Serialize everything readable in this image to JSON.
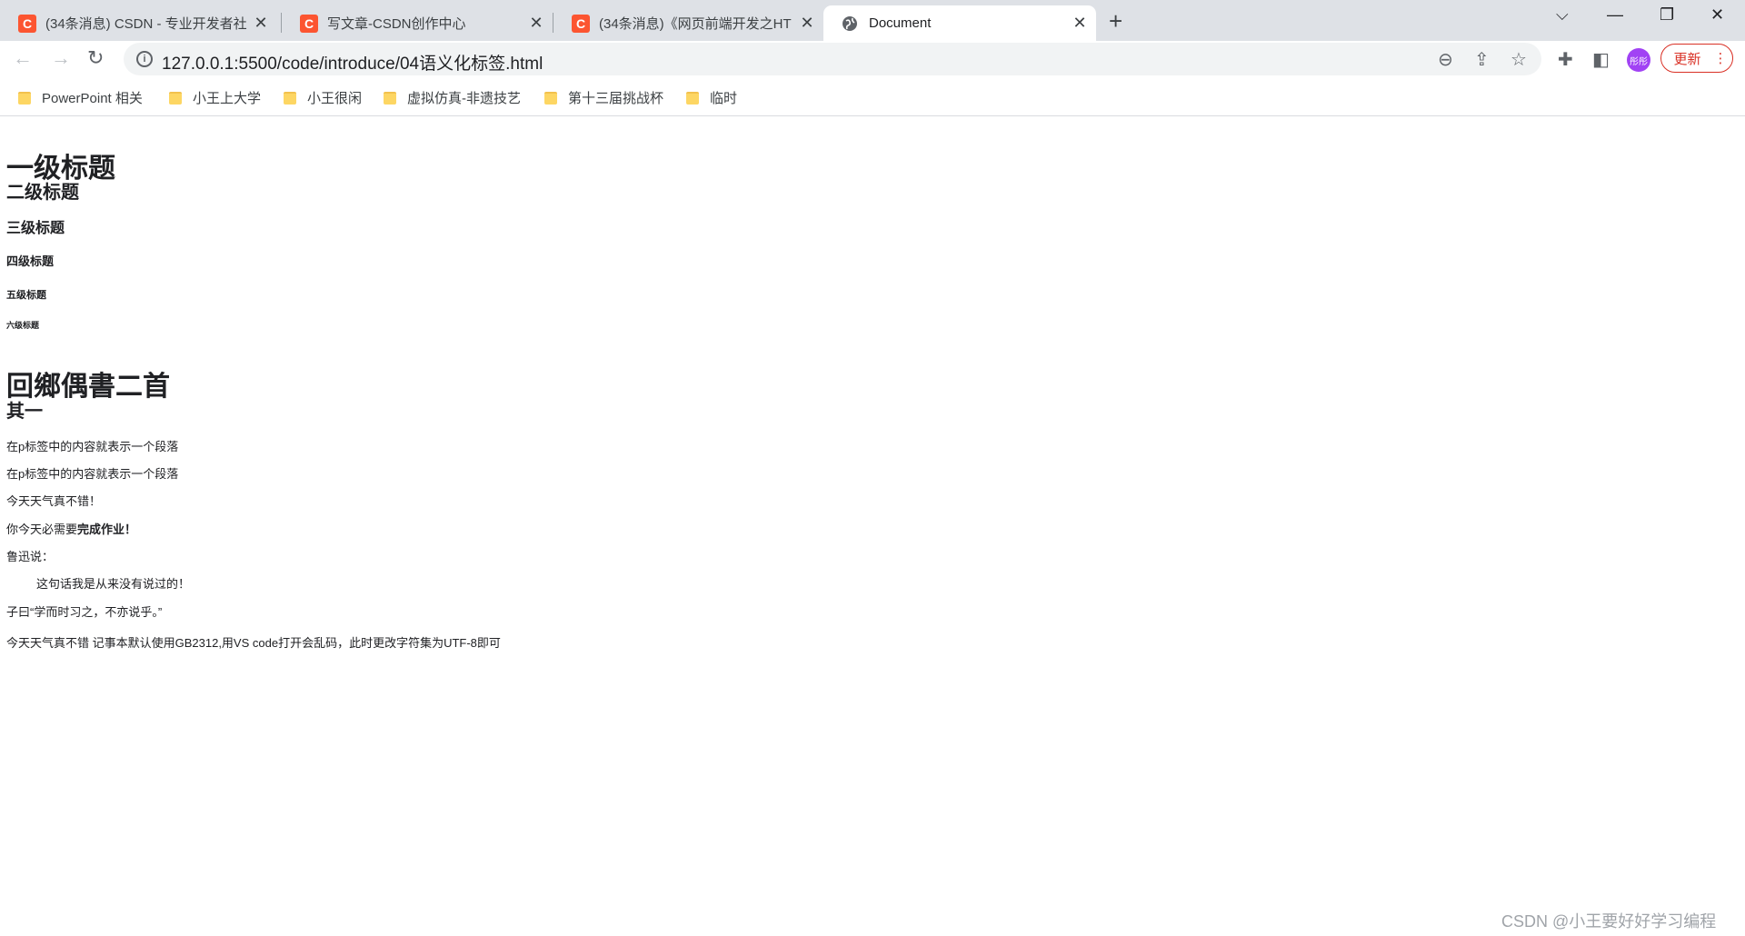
{
  "browser": {
    "tabs": [
      {
        "title": "(34条消息) CSDN - 专业开发者社",
        "favicon": "C"
      },
      {
        "title": "写文章-CSDN创作中心",
        "favicon": "C"
      },
      {
        "title": "(34条消息)《网页前端开发之HT",
        "favicon": "C"
      },
      {
        "title": "Document",
        "favicon": "globe-icon"
      }
    ],
    "new_tab": "+",
    "url": "127.0.0.1:5500/code/introduce/04语义化标签.html",
    "update_label": "更新",
    "avatar_text": "彤彤",
    "accent_color": "#d93025"
  },
  "bookmarks": [
    {
      "label": "PowerPoint 相关"
    },
    {
      "label": "小王上大学"
    },
    {
      "label": "小王很闲"
    },
    {
      "label": "虚拟仿真-非遗技艺"
    },
    {
      "label": "第十三届挑战杯"
    },
    {
      "label": "临时"
    }
  ],
  "page": {
    "h1": "一级标题",
    "h2": "二级标题",
    "h3": "三级标题",
    "h4": "四级标题",
    "h5": "五级标题",
    "h6": "六级标题",
    "poem_title": "回鄉偶書二首",
    "poem_sub": "其一",
    "p1": "在p标签中的内容就表示一个段落",
    "p2": "在p标签中的内容就表示一个段落",
    "p3": "今天天气真不错！",
    "p4_normal": "你今天必需要",
    "p4_strong": "完成作业！",
    "p5": "鲁迅说：",
    "quote": "这句话我是从来没有说过的！",
    "p6": "子曰“学而时习之，不亦说乎。”",
    "p7": "今天天气真不错 记事本默认使用GB2312,用VS code打开会乱码，此时更改字符集为UTF-8即可"
  },
  "watermark": "CSDN @小王要好好学习编程"
}
